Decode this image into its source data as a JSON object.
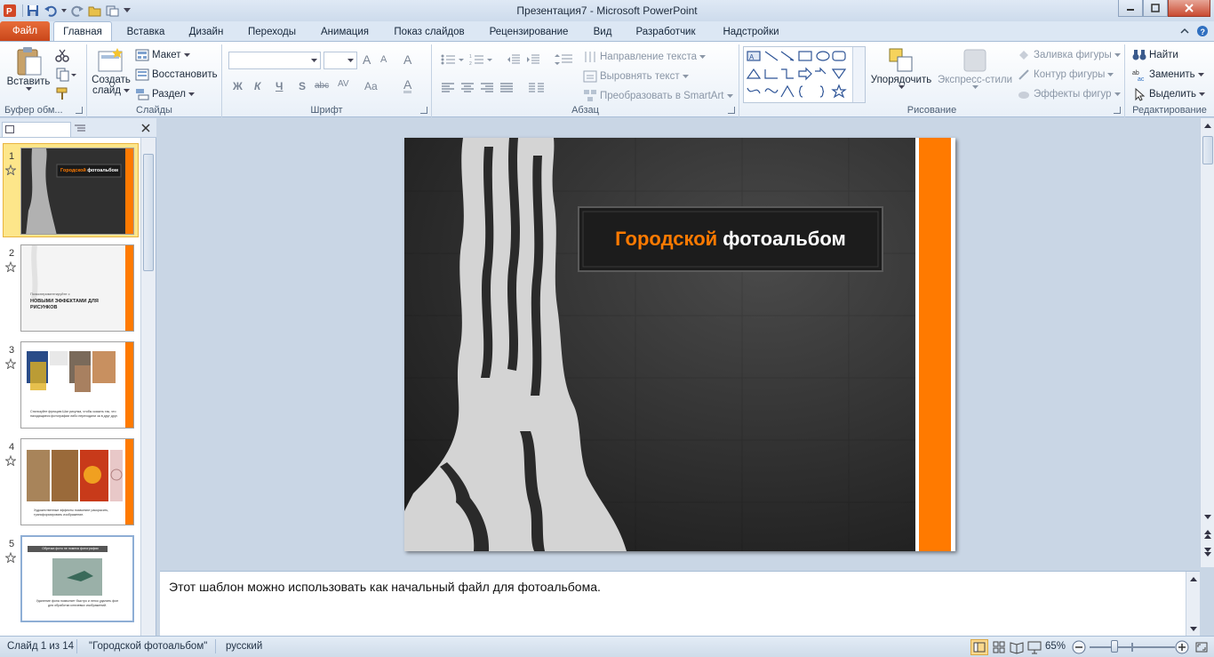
{
  "window": {
    "title": "Презентация7  -  Microsoft PowerPoint"
  },
  "tabs": {
    "file": "Файл",
    "items": [
      "Главная",
      "Вставка",
      "Дизайн",
      "Переходы",
      "Анимация",
      "Показ слайдов",
      "Рецензирование",
      "Вид",
      "Разработчик",
      "Надстройки"
    ]
  },
  "ribbon": {
    "clipboard": {
      "paste": "Вставить",
      "label": "Буфер обм..."
    },
    "slides": {
      "new_slide_1": "Создать",
      "new_slide_2": "слайд",
      "layout": "Макет",
      "reset": "Восстановить",
      "section": "Раздел",
      "label": "Слайды"
    },
    "font": {
      "bold": "Ж",
      "italic": "К",
      "underline": "Ч",
      "shadow": "S",
      "strike": "abc",
      "spacing": "AV",
      "case": "Aa",
      "grow": "A",
      "shrink": "A",
      "color": "A",
      "clear": "A",
      "label": "Шрифт"
    },
    "paragraph": {
      "text_direction": "Направление текста",
      "align_text": "Выровнять текст",
      "smartart": "Преобразовать в SmartArt",
      "label": "Абзац"
    },
    "drawing": {
      "arrange": "Упорядочить",
      "quick_styles": "Экспресс-стили",
      "fill": "Заливка фигуры",
      "outline": "Контур фигуры",
      "effects": "Эффекты фигур",
      "label": "Рисование"
    },
    "editing": {
      "find": "Найти",
      "replace": "Заменить",
      "select": "Выделить",
      "label": "Редактирование"
    }
  },
  "slides_panel": {
    "thumbnails": [
      {
        "num": "1",
        "title_orange": "Городской",
        "title_white": "фотоальбом"
      },
      {
        "num": "2",
        "caption_small": "Поэкспериментируйте с",
        "caption_big": "НОВЫМИ ЭФФЕКТАМИ ДЛЯ РИСУНКОВ"
      },
      {
        "num": "3",
        "caption": "Стилизуйте функцию Шаг рисунка, чтобы сказать так, что находящиеся фотографии либо переходили за в друг друг."
      },
      {
        "num": "4",
        "caption": "Художественные эффекты позволяют раскрасить, трансформировать изображение."
      },
      {
        "num": "5",
        "title": "Обрезка фото не помеха фотографии",
        "caption": "Удаление фона позволяет быстро и легко удалить фон для обработки ключевых изображений."
      }
    ]
  },
  "slide": {
    "title_orange": "Городской",
    "title_white": "фотоальбом"
  },
  "notes": {
    "text": "Этот шаблон можно использовать как начальный файл для фотоальбома."
  },
  "status": {
    "slide": "Слайд 1 из 14",
    "theme": "\"Городской фотоальбом\"",
    "language": "русский",
    "zoom": "65%"
  },
  "colors": {
    "accent": "#ff7a00",
    "file_tab": "#d65424"
  }
}
